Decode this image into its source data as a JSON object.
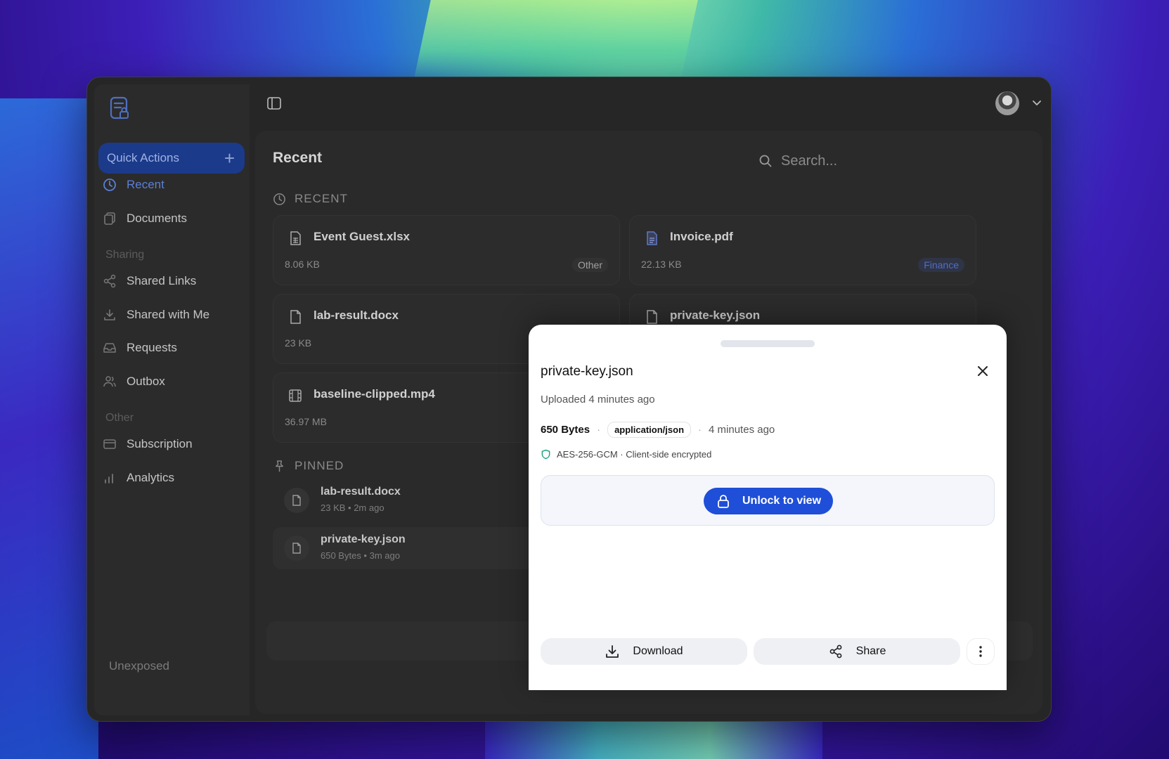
{
  "sidebar": {
    "quick_actions_label": "Quick Actions",
    "nav": [
      {
        "label": "Recent",
        "icon": "clock-icon"
      },
      {
        "label": "Documents",
        "icon": "documents-icon"
      },
      {
        "label": "Shared Links",
        "icon": "share-icon"
      },
      {
        "label": "Shared with Me",
        "icon": "download-icon"
      },
      {
        "label": "Requests",
        "icon": "inbox-icon"
      },
      {
        "label": "Outbox",
        "icon": "users-icon"
      },
      {
        "label": "Subscription",
        "icon": "credit-card-icon"
      },
      {
        "label": "Analytics",
        "icon": "bar-chart-icon"
      }
    ],
    "section_sharing": "Sharing",
    "section_other": "Other",
    "footer_label": "Unexposed"
  },
  "main": {
    "page_title": "Recent",
    "search_placeholder": "Search...",
    "recent_heading": "RECENT",
    "pinned_heading": "PINNED",
    "recent_files": [
      {
        "name": "Event Guest.xlsx",
        "size": "8.06 KB",
        "tag": "Other"
      },
      {
        "name": "Invoice.pdf",
        "size": "22.13 KB",
        "tag": "Finance"
      },
      {
        "name": "lab-result.docx",
        "size": "23 KB",
        "tag": ""
      },
      {
        "name": "private-key.json",
        "size": "",
        "tag": ""
      },
      {
        "name": "baseline-clipped.mp4",
        "size": "36.97 MB",
        "tag": ""
      }
    ],
    "pinned_files": [
      {
        "name": "lab-result.docx",
        "meta": "23 KB • 2m ago"
      },
      {
        "name": "private-key.json",
        "meta": "650 Bytes • 3m ago"
      }
    ]
  },
  "modal": {
    "title": "private-key.json",
    "subtitle": "Uploaded 4 minutes ago",
    "size": "650 Bytes",
    "mime": "application/json",
    "age": "4 minutes ago",
    "encryption": "AES-256-GCM · Client-side encrypted",
    "unlock_label": "Unlock to view",
    "download_label": "Download",
    "share_label": "Share"
  },
  "colors": {
    "accent": "#1f4fd8",
    "shield": "#16a37a",
    "finance_tag": "#4f6fc0"
  }
}
